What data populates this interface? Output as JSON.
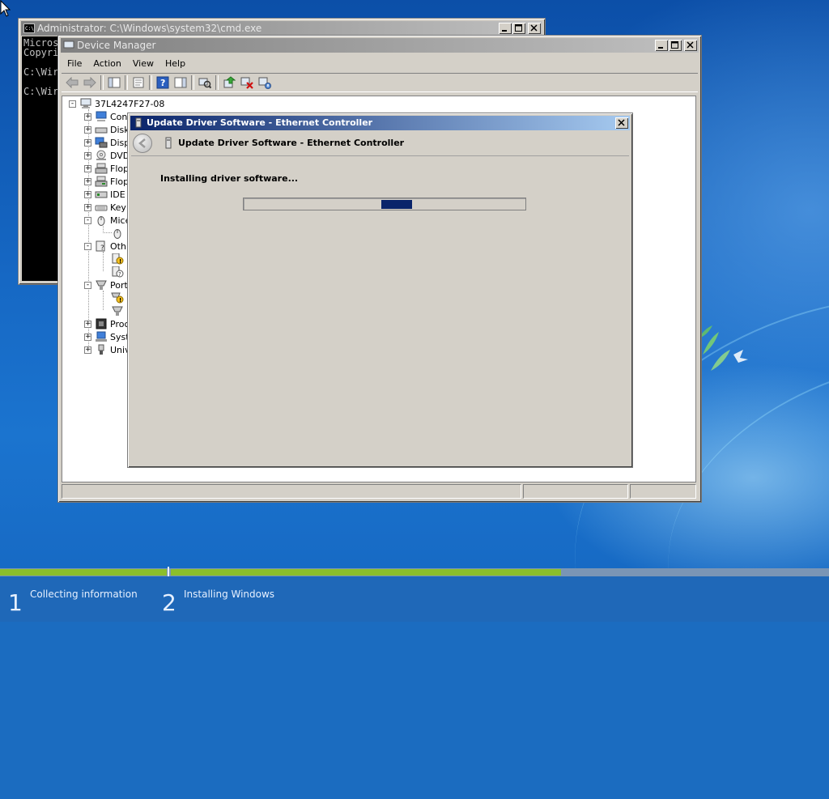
{
  "cmd": {
    "title": "Administrator: C:\\Windows\\system32\\cmd.exe",
    "lines": [
      "Micros",
      "Copyri",
      "",
      "C:\\Wir",
      "",
      "C:\\Wir"
    ]
  },
  "device_manager": {
    "title": "Device Manager",
    "menu": [
      "File",
      "Action",
      "View",
      "Help"
    ],
    "toolbar_icons": [
      "back-arrow-icon",
      "forward-arrow-icon",
      "show-hide-tree-icon",
      "properties-icon",
      "help-icon",
      "show-hide-action-pane-icon",
      "scan-hardware-icon",
      "update-driver-icon",
      "uninstall-icon",
      "enable-disable-icon"
    ],
    "root_label": "37L4247F27-08",
    "tree": [
      {
        "label": "Con",
        "icon": "computer-icon",
        "expander": "+"
      },
      {
        "label": "Disk",
        "icon": "disk-drive-icon",
        "expander": "+"
      },
      {
        "label": "Disp",
        "icon": "display-adapter-icon",
        "expander": "+"
      },
      {
        "label": "DVD",
        "icon": "dvd-drive-icon",
        "expander": "+"
      },
      {
        "label": "Flop",
        "icon": "floppy-controller-icon",
        "expander": "+"
      },
      {
        "label": "Flop",
        "icon": "floppy-drive-icon",
        "expander": "+"
      },
      {
        "label": "IDE",
        "icon": "ide-controller-icon",
        "expander": "+"
      },
      {
        "label": "Key",
        "icon": "keyboard-icon",
        "expander": "+"
      },
      {
        "label": "Mice",
        "icon": "mouse-icon",
        "expander": "-"
      },
      {
        "label": "",
        "icon": "mouse-device-icon",
        "expander": ""
      },
      {
        "label": "Oth",
        "icon": "other-devices-icon",
        "expander": "-"
      },
      {
        "label": "",
        "icon": "unknown-device-warning-icon",
        "expander": ""
      },
      {
        "label": "",
        "icon": "unknown-device-icon",
        "expander": ""
      },
      {
        "label": "Port",
        "icon": "ports-icon",
        "expander": "-"
      },
      {
        "label": "",
        "icon": "port-warning-icon",
        "expander": ""
      },
      {
        "label": "",
        "icon": "port-icon",
        "expander": ""
      },
      {
        "label": "Proc",
        "icon": "processor-icon",
        "expander": "+"
      },
      {
        "label": "Syst",
        "icon": "system-devices-icon",
        "expander": "+"
      },
      {
        "label": "Univ",
        "icon": "usb-controller-icon",
        "expander": "+"
      }
    ]
  },
  "dialog": {
    "title": "Update Driver Software - Ethernet Controller",
    "heading": "Update Driver Software - Ethernet Controller",
    "status": "Installing driver software...",
    "progress_style": "marquee"
  },
  "setup": {
    "steps": [
      {
        "number": "1",
        "label": "Collecting information"
      },
      {
        "number": "2",
        "label": "Installing Windows"
      }
    ],
    "step1_progress": 1.0,
    "step2_progress": 0.6
  },
  "colors": {
    "title_active": "#0a246a",
    "progress_fill": "#0a246a",
    "setup_green": "#8bbf2c"
  }
}
